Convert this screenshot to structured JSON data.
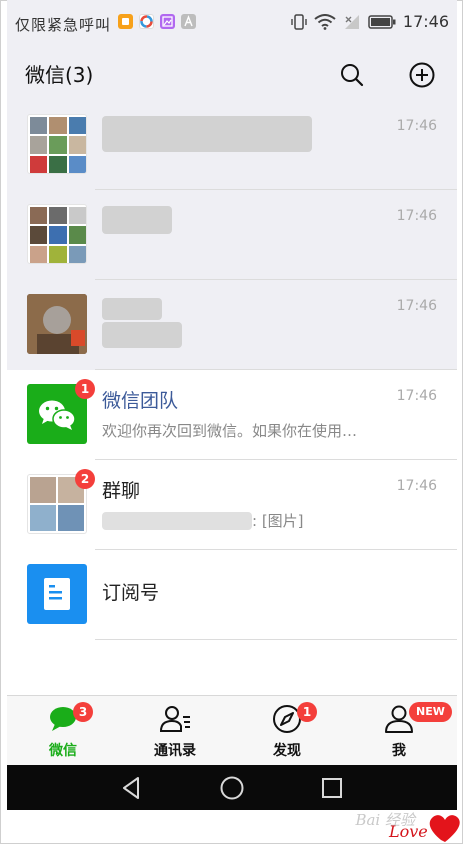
{
  "status_bar": {
    "carrier": "仅限紧急呼叫",
    "time": "17:46",
    "notif_icons": [
      "orange-app-icon",
      "color-wheel-icon",
      "purple-image-icon",
      "letter-a-icon"
    ],
    "notif_colors": [
      "#f7a11a",
      "#ffffff",
      "#b168f0",
      "#bdbdbd"
    ]
  },
  "header": {
    "title": "微信(3)",
    "search_icon": "search-icon",
    "add_icon": "plus-circle-icon"
  },
  "chats": [
    {
      "name": "",
      "preview": "",
      "time": "17:46",
      "badge": ""
    },
    {
      "name": "",
      "preview": "",
      "time": "17:46",
      "badge": ""
    },
    {
      "name": "",
      "preview": "",
      "time": "17:46",
      "badge": ""
    },
    {
      "name": "微信团队",
      "preview": "欢迎你再次回到微信。如果你在使用…",
      "time": "17:46",
      "badge": "1"
    },
    {
      "name": "群聊",
      "preview": ": [图片]",
      "time": "17:46",
      "badge": "2"
    },
    {
      "name": "订阅号",
      "preview": "",
      "time": "",
      "badge": ""
    }
  ],
  "tabs": [
    {
      "label": "微信",
      "badge": "3",
      "icon": "chat-bubble-icon"
    },
    {
      "label": "通讯录",
      "badge": "",
      "icon": "contacts-icon"
    },
    {
      "label": "发现",
      "badge": "1",
      "icon": "compass-icon"
    },
    {
      "label": "我",
      "badge": "NEW",
      "icon": "person-icon"
    }
  ],
  "colors": {
    "wechat_green": "#1aad19",
    "badge_red": "#f43f3b",
    "link_blue": "#3c5a99",
    "subscription_blue": "#1a8ff0"
  },
  "watermark": {
    "text": "Bai 经验"
  }
}
